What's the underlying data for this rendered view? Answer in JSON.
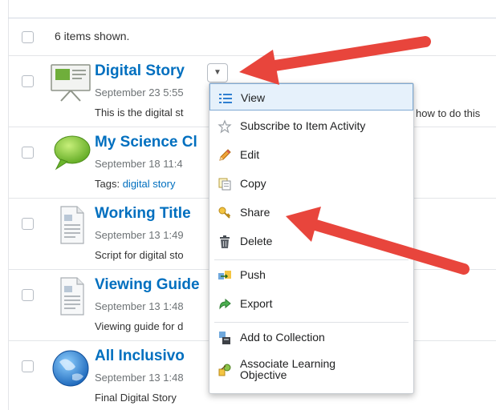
{
  "list": {
    "summary": "6 items shown.",
    "items": [
      {
        "title": "Digital Story",
        "date": "September 23 5:55",
        "desc": "This is the digital st",
        "thumb": "presentation-icon"
      },
      {
        "title": "My Science Cl",
        "date": "September 18 11:4",
        "tags_label": "Tags:",
        "tag": "digital story",
        "thumb": "speech-bubble-icon"
      },
      {
        "title": "Working Title",
        "date": "September 13 1:49",
        "desc": "Script for digital sto",
        "thumb": "document-icon"
      },
      {
        "title": "Viewing Guide",
        "date": "September 13 1:48",
        "desc": "Viewing guide for d",
        "thumb": "document-icon"
      },
      {
        "title": "All Inclusivo",
        "date": "September 13 1:48",
        "desc": "Final Digital Story",
        "thumb": "globe-icon"
      }
    ],
    "first_desc_tail": "how to do this"
  },
  "menu": {
    "items": [
      {
        "label": "View",
        "icon": "list-icon"
      },
      {
        "label": "Subscribe to Item Activity",
        "icon": "star-icon"
      },
      {
        "label": "Edit",
        "icon": "pencil-icon"
      },
      {
        "label": "Copy",
        "icon": "copy-icon"
      },
      {
        "label": "Share",
        "icon": "key-icon"
      },
      {
        "label": "Delete",
        "icon": "trash-icon"
      },
      {
        "label": "Push",
        "icon": "push-icon"
      },
      {
        "label": "Export",
        "icon": "export-icon"
      },
      {
        "label": "Add to Collection",
        "icon": "collection-icon"
      },
      {
        "label": "Associate Learning Objective",
        "label_line1": "Associate Learning",
        "label_line2": "Objective",
        "icon": "objective-icon"
      }
    ]
  },
  "colors": {
    "accent": "#006fbf",
    "arrow": "#e8453c",
    "menu_active": "#e6f1fb"
  }
}
